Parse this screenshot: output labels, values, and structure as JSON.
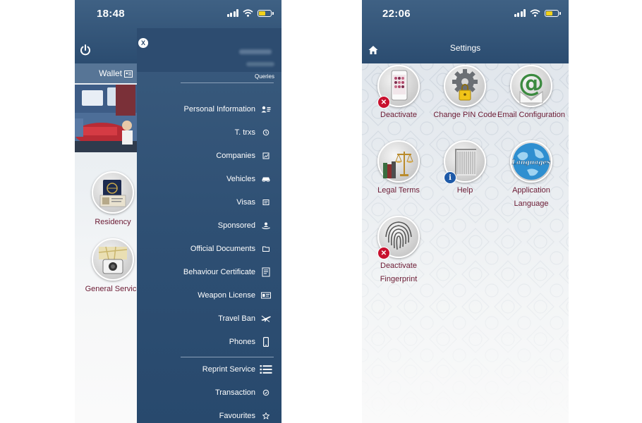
{
  "left_screen": {
    "status": {
      "time": "18:48"
    },
    "wallet": {
      "label": "Wallet"
    },
    "home_icons": [
      {
        "label": "Residency"
      },
      {
        "label": "General Service"
      }
    ],
    "menu": {
      "close_label": "X",
      "section_label": "Queries",
      "items": [
        {
          "label": "Personal Information",
          "icon": "person-card-icon"
        },
        {
          "label": "T. trxs",
          "icon": "clock-icon"
        },
        {
          "label": "Companies",
          "icon": "chart-icon"
        },
        {
          "label": "Vehicles",
          "icon": "car-icon"
        },
        {
          "label": "Visas",
          "icon": "document-icon"
        },
        {
          "label": "Sponsored",
          "icon": "people-icon"
        },
        {
          "label": "Official Documents",
          "icon": "folder-icon"
        },
        {
          "label": "Behaviour Certificate",
          "icon": "certificate-icon"
        },
        {
          "label": "Weapon License",
          "icon": "license-card-icon"
        },
        {
          "label": "Travel Ban",
          "icon": "plane-icon"
        },
        {
          "label": "Phones",
          "icon": "phone-icon"
        },
        {
          "label": "Reprint Service",
          "icon": "list-icon"
        },
        {
          "label": "Transaction",
          "icon": "check-circle-icon"
        },
        {
          "label": "Favourites",
          "icon": "star-icon"
        }
      ]
    }
  },
  "right_screen": {
    "status": {
      "time": "22:06"
    },
    "header": {
      "title": "Settings"
    },
    "tiles": [
      {
        "label": "Deactivate",
        "icon": "phone-deactivate-icon"
      },
      {
        "label": "Change PIN Code",
        "icon": "gear-lock-icon"
      },
      {
        "label": "Email Configuration",
        "icon": "email-at-icon"
      },
      {
        "label": "Legal Terms",
        "icon": "scales-icon"
      },
      {
        "label": "Help",
        "icon": "help-book-icon"
      },
      {
        "label": "Application Language",
        "icon": "globe-languages-icon",
        "icon_text": "Languages"
      },
      {
        "label": "Deactivate Fingerprint",
        "icon": "fingerprint-icon"
      }
    ]
  },
  "colors": {
    "header": "#2b4c70",
    "menu": "#2e4f73",
    "label": "#6b1a33",
    "badge_red": "#c8102e",
    "badge_blue": "#1e5aa8",
    "battery": "#f2d11a"
  }
}
